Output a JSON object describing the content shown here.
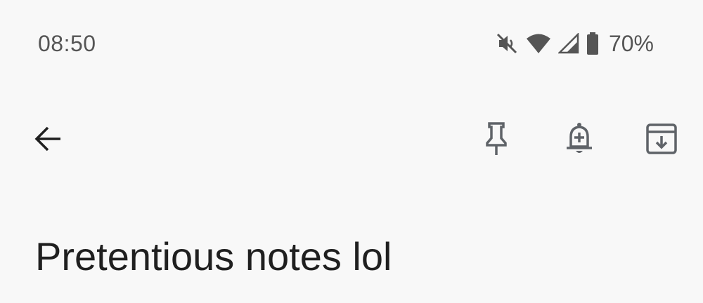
{
  "status_bar": {
    "time": "08:50",
    "battery_percent": "70%",
    "icons": [
      "vibrate-off-icon",
      "wifi-icon",
      "cellular-signal-icon",
      "battery-icon"
    ]
  },
  "toolbar": {
    "back_icon": "arrow-back-icon",
    "pin_icon": "pin-icon",
    "reminder_icon": "add-alert-icon",
    "archive_icon": "archive-icon"
  },
  "note": {
    "title": "Pretentious notes lol"
  },
  "colors": {
    "background": "#f8f8f8",
    "icon": "#5f6368",
    "text": "#1f1f1f",
    "status_text": "#555555"
  }
}
